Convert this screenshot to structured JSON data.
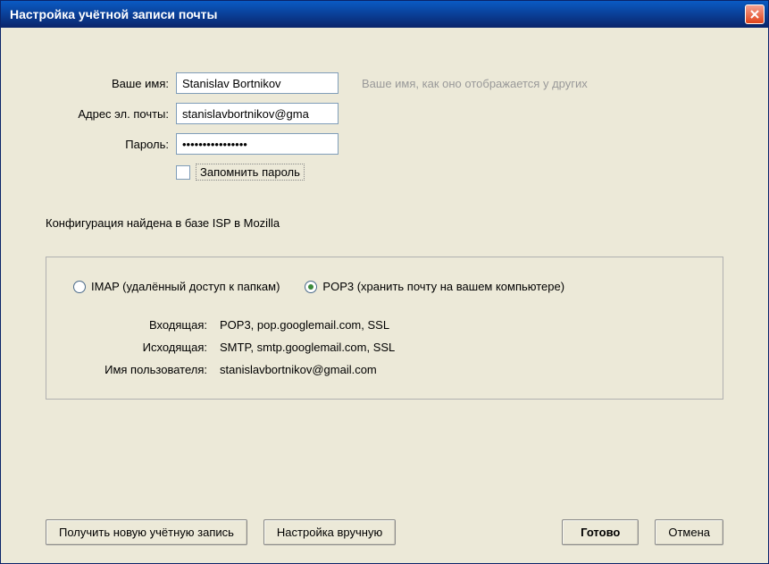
{
  "window": {
    "title": "Настройка учётной записи почты"
  },
  "form": {
    "name_label": "Ваше имя:",
    "name_value": "Stanislav Bortnikov",
    "name_hint": "Ваше имя, как оно отображается у других",
    "email_label": "Адрес эл. почты:",
    "email_value": "stanislavbortnikov@gma",
    "password_label": "Пароль:",
    "password_value": "••••••••••••••••",
    "remember_label": "Запомнить пароль",
    "remember_checked": false
  },
  "status": "Конфигурация найдена в базе ISP в Mozilla",
  "protocol": {
    "imap_label": "IMAP (удалённый доступ к папкам)",
    "pop3_label": "POP3 (хранить почту на вашем компьютере)",
    "selected": "pop3"
  },
  "config": {
    "incoming_label": "Входящая:",
    "incoming_value": "POP3, pop.googlemail.com, SSL",
    "outgoing_label": "Исходящая:",
    "outgoing_value": "SMTP, smtp.googlemail.com, SSL",
    "username_label": "Имя пользователя:",
    "username_value": "stanislavbortnikov@gmail.com"
  },
  "buttons": {
    "new_account": "Получить новую учётную запись",
    "manual": "Настройка вручную",
    "done": "Готово",
    "cancel": "Отмена"
  }
}
